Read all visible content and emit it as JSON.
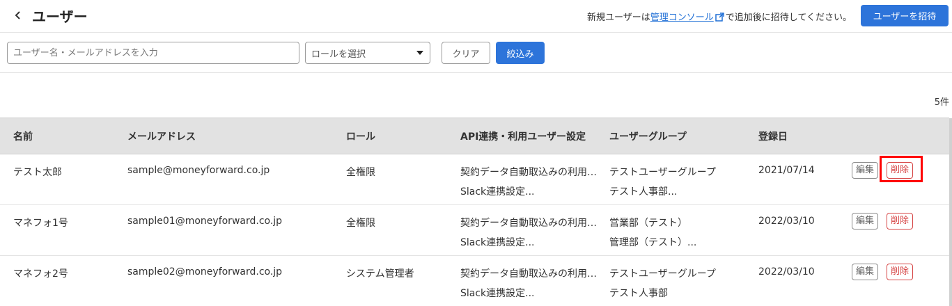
{
  "header": {
    "title": "ユーザー",
    "notice_prefix": "新規ユーザーは",
    "notice_link": "管理コンソール",
    "notice_suffix": "で追加後に招待してください。",
    "invite_button": "ユーザーを招待"
  },
  "filters": {
    "search_placeholder": "ユーザー名・メールアドレスを入力",
    "role_placeholder": "ロールを選択",
    "clear_button": "クリア",
    "filter_button": "絞込み"
  },
  "count": "5件",
  "table": {
    "columns": [
      "名前",
      "メールアドレス",
      "ロール",
      "API連携・利用ユーザー設定",
      "ユーザーグループ",
      "登録日"
    ],
    "edit_label": "編集",
    "delete_label": "削除",
    "rows": [
      {
        "name": "テスト太郎",
        "email": "sample@moneyforward.co.jp",
        "role": "全権限",
        "api1": "契約データ自動取込みの利用…",
        "api2": "Slack連携設定...",
        "group1": "テストユーザーグループ",
        "group2": "テスト人事部...",
        "date": "2021/07/14"
      },
      {
        "name": "マネフォ1号",
        "email": "sample01@moneyforward.co.jp",
        "role": "全権限",
        "api1": "契約データ自動取込みの利用…",
        "api2": "Slack連携設定...",
        "group1": "営業部（テスト）",
        "group2": "管理部（テスト）...",
        "date": "2022/03/10"
      },
      {
        "name": "マネフォ2号",
        "email": "sample02@moneyforward.co.jp",
        "role": "システム管理者",
        "api1": "契約データ自動取込みの利用…",
        "api2": "Slack連携設定...",
        "group1": "テストユーザーグループ",
        "group2": "テスト人事部",
        "date": "2022/03/10"
      }
    ]
  },
  "colors": {
    "primary": "#2d74da",
    "danger": "#d64545",
    "highlight": "#ff0000",
    "header_bg": "#e2e2e2"
  },
  "icons": [
    "chevron-left-icon",
    "external-link-icon",
    "caret-down-icon"
  ]
}
